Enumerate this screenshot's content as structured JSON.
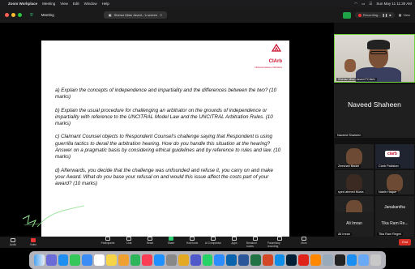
{
  "menubar": {
    "app": "Zoom Workplace",
    "menus": [
      "Meeting",
      "View",
      "Edit",
      "Window",
      "Help"
    ],
    "clock": "Sun May 11 11:30 AM"
  },
  "topbar": {
    "title": "Meeting",
    "share_tab": "Sheraz Mian Javed...'s screen",
    "recording": "Recording...",
    "view": "View"
  },
  "document": {
    "logo_title": "CIArb",
    "logo_subtitle": "Chartered Institute of Arbitrators",
    "q_a": "a)    Explain the concepts of independence and impartiality and the differences between the two? (10 marks)",
    "q_b": "b)    Explain the usual procedure for challenging an arbitrator on the grounds of independence or impartiality with reference to the UNCITRAL Model Law and the  UNCITRAL Arbitration Rules.  (10 marks)",
    "q_c": "c)    Claimant Counsel objects to Respondent Counsel's challenge saying that Respondent is using guerrilla tactics to derail the arbitration hearing. How do you handle this situation at the hearing? Answer on a pragmatic basis by considering ethical guidelines and by reference to rules and law. (10 marks)",
    "q_d": "d)    Afterwards, you decide that the challenge was unfounded and refuse it, you carry on and make your Award. What do you base your refusal on and would this issue affect the costs part of your award? (10 marks)"
  },
  "gallery": {
    "speaker_name": "Sheraz Mian Javed FCIArb",
    "naveed_big": "Naveed Shaheen",
    "naveed_small": "Naveed Shaheen",
    "tiles": [
      {
        "name": "Zeeshan Badar"
      },
      {
        "name": "Ciarb Pakistan",
        "badge": "ciarb"
      },
      {
        "name": "syed ahmed Murta"
      },
      {
        "name": "Nabih Haque"
      },
      {
        "name": "Faisal Younas"
      },
      {
        "name": "Janakantha",
        "big": "Janakantha"
      },
      {
        "name": "Ali Imran",
        "big": "Ali Imran"
      },
      {
        "name": "Tika Ram Regmi",
        "big": "Tika Ram Re..."
      }
    ]
  },
  "toolbar": {
    "audio": "Audio",
    "video": "Video",
    "participants": "Participants",
    "participants_count": "13",
    "chat": "Chat",
    "react": "React",
    "share": "Share",
    "host_tools": "Host tools",
    "ai_companion": "AI Companion",
    "apps": "Apps",
    "breakout": "Breakout rooms",
    "pause_rec": "Pause/stop recording",
    "more": "More",
    "end": "End"
  },
  "colors": {
    "accent_green": "#2ecc71",
    "ciarb_red": "#c8102e",
    "end_red": "#d93025"
  }
}
